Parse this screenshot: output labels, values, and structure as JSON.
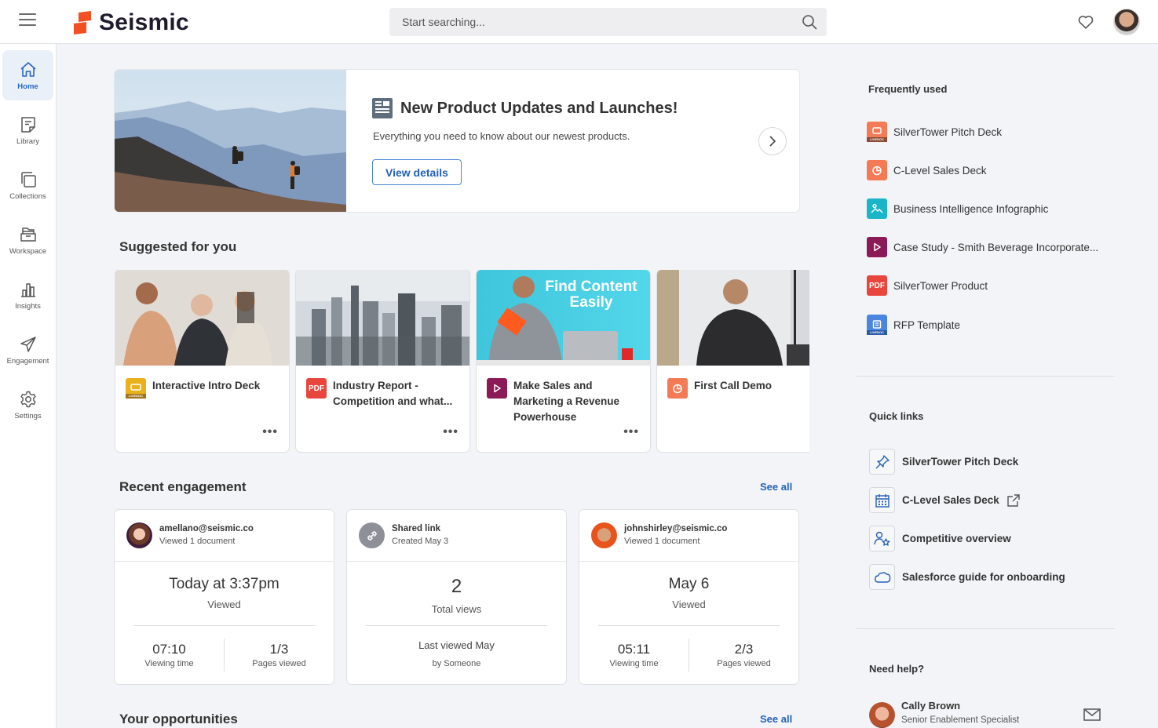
{
  "app": {
    "brand_name": "Seismic",
    "brand_color": "#f25022"
  },
  "search": {
    "placeholder": "Start searching...",
    "value": ""
  },
  "sidebar": {
    "items": [
      {
        "label": "Home",
        "icon": "home-icon",
        "active": true
      },
      {
        "label": "Library",
        "icon": "library-icon"
      },
      {
        "label": "Collections",
        "icon": "collections-icon"
      },
      {
        "label": "Workspace",
        "icon": "workspace-icon"
      },
      {
        "label": "Insights",
        "icon": "insights-icon"
      },
      {
        "label": "Engagement",
        "icon": "engagement-icon"
      },
      {
        "label": "Settings",
        "icon": "settings-icon"
      }
    ]
  },
  "hero": {
    "title": "New Product Updates and Launches!",
    "description": "Everything you need to know about our newest products.",
    "button_label": "View details",
    "image": "hikers on mountain ridge"
  },
  "suggested": {
    "title": "Suggested for you",
    "items": [
      {
        "name": "Interactive Intro Deck",
        "type": "livedoc",
        "color": "#e9b21c",
        "thumb": "team meeting"
      },
      {
        "name": "Industry Report - Competition and what...",
        "type": "pdf",
        "color": "#e8453c",
        "badge": "PDF",
        "thumb": "city skyline"
      },
      {
        "name": "Make Sales and Marketing a Revenue Powerhouse",
        "type": "video",
        "color": "#8b1a56",
        "thumb": "Find Content Easily"
      },
      {
        "name": "First Call Demo",
        "type": "presentation",
        "color": "#f47a55",
        "thumb": "man with headset"
      }
    ],
    "thumb_overlay_text": "Find Content Easily"
  },
  "engagement": {
    "title": "Recent engagement",
    "see_all": "See all",
    "cards": [
      {
        "name": "amellano@seismic.co",
        "sub": "Viewed 1 document",
        "big": "Today at 3:37pm",
        "mid": "Viewed",
        "stat1_value": "07:10",
        "stat1_label": "Viewing time",
        "stat2_value": "1/3",
        "stat2_label": "Pages viewed"
      },
      {
        "name": "Shared link",
        "sub": "Created May 3",
        "big": "2",
        "mid": "Total views",
        "foot1": "Last viewed May",
        "foot2": "by Someone"
      },
      {
        "name": "johnshirley@seismic.co",
        "sub": "Viewed 1 document",
        "big": "May 6",
        "mid": "Viewed",
        "stat1_value": "05:11",
        "stat1_label": "Viewing time",
        "stat2_value": "2/3",
        "stat2_label": "Pages viewed"
      }
    ]
  },
  "opportunities": {
    "title": "Your opportunities",
    "see_all": "See all"
  },
  "frequently_used": {
    "title": "Frequently used",
    "items": [
      {
        "label": "SilverTower Pitch Deck",
        "type": "livedoc",
        "color": "#f47a55"
      },
      {
        "label": "C-Level Sales Deck",
        "type": "presentation",
        "color": "#f47a55"
      },
      {
        "label": "Business Intelligence Infographic",
        "type": "image",
        "color": "#1ab5c9"
      },
      {
        "label": "Case Study - Smith Beverage Incorporate...",
        "type": "video",
        "color": "#8b1a56"
      },
      {
        "label": "SilverTower Product",
        "type": "pdf",
        "color": "#e8453c",
        "badge": "PDF"
      },
      {
        "label": "RFP Template",
        "type": "livedoc",
        "color": "#4a86e0"
      }
    ]
  },
  "quick_links": {
    "title": "Quick links",
    "items": [
      {
        "label": "SilverTower Pitch Deck",
        "icon": "pin-icon"
      },
      {
        "label": "C-Level Sales Deck",
        "icon": "calendar-icon",
        "external": true
      },
      {
        "label": "Competitive overview",
        "icon": "user-star-icon"
      },
      {
        "label": "Salesforce guide for onboarding",
        "icon": "cloud-icon"
      }
    ]
  },
  "help": {
    "title": "Need help?",
    "name": "Cally Brown",
    "role": "Senior Enablement Specialist"
  },
  "badges": {
    "livedoc": "LIVEDOC"
  }
}
